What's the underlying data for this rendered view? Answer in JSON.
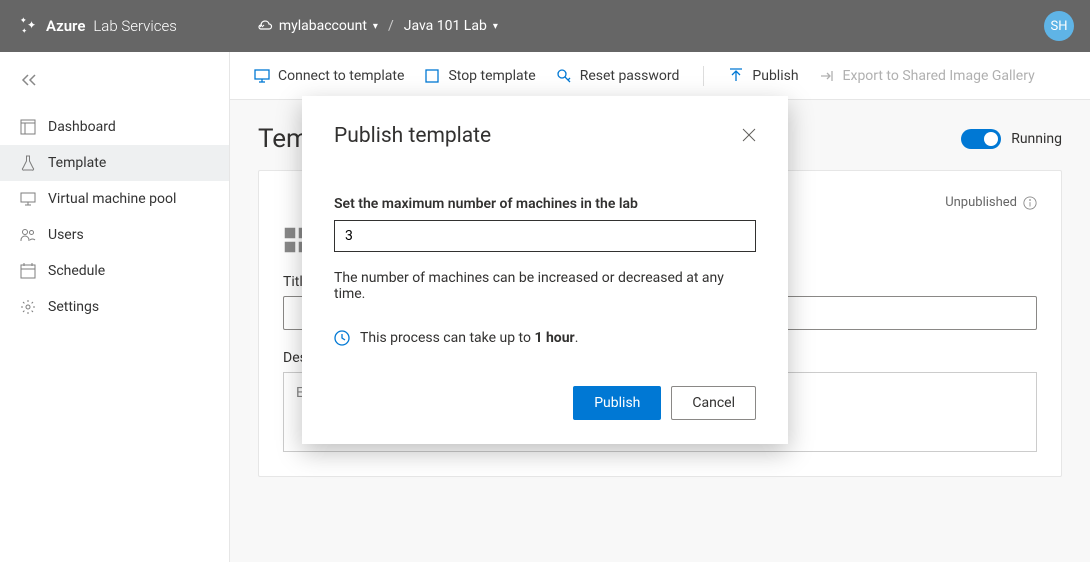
{
  "brand": {
    "strong": "Azure",
    "light": " Lab Services"
  },
  "breadcrumb": {
    "account": "mylabaccount",
    "lab": "Java 101 Lab"
  },
  "avatar": "SH",
  "sidebar": {
    "items": [
      {
        "label": "Dashboard"
      },
      {
        "label": "Template"
      },
      {
        "label": "Virtual machine pool"
      },
      {
        "label": "Users"
      },
      {
        "label": "Schedule"
      },
      {
        "label": "Settings"
      }
    ]
  },
  "toolbar": {
    "connect": "Connect to template",
    "stop": "Stop template",
    "reset": "Reset password",
    "publish": "Publish",
    "export": "Export to Shared Image Gallery"
  },
  "page": {
    "title": "Template",
    "status_label": "Running",
    "unpublished": "Unpublished",
    "title_field_label": "Title",
    "desc_field_label": "Description",
    "desc_placeholder": "Enter a description for the lab. This description will be visible to students."
  },
  "modal": {
    "title": "Publish template",
    "max_label": "Set the maximum number of machines in the lab",
    "max_value": "3",
    "note": "The number of machines can be increased or decreased at any time.",
    "info_prefix": "This process can take up to ",
    "info_bold": "1 hour",
    "info_suffix": ".",
    "publish_btn": "Publish",
    "cancel_btn": "Cancel"
  }
}
